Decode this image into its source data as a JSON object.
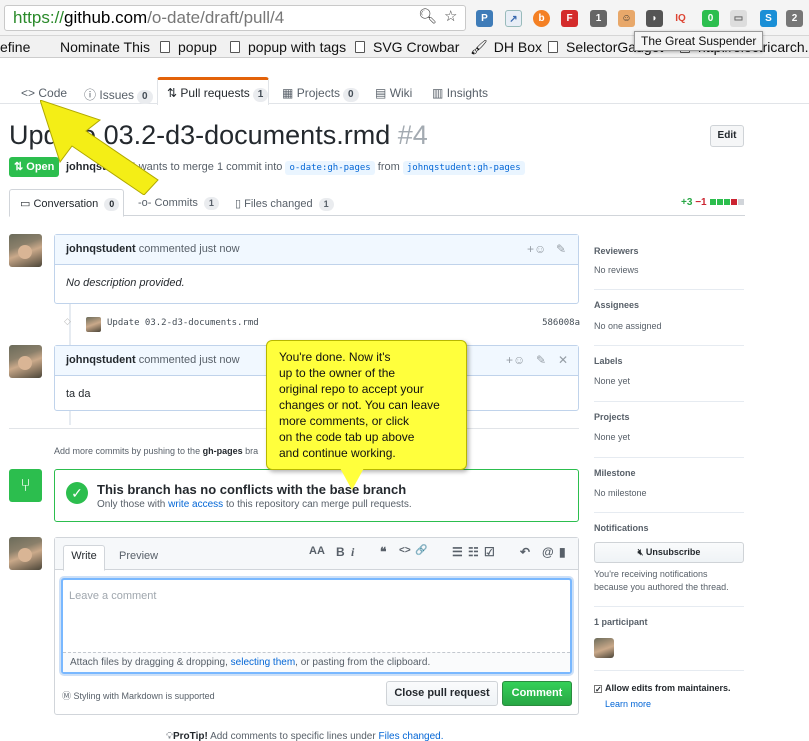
{
  "browser": {
    "url_scheme": "https://",
    "url_host": "github.com",
    "url_path": "/o-date/draft/pull/4",
    "bookmarks": [
      {
        "label": "efine"
      },
      {
        "label": "Nominate This"
      },
      {
        "label": "popup"
      },
      {
        "label": "popup with tags"
      },
      {
        "label": "SVG Crowbar"
      },
      {
        "label": "DH Box"
      },
      {
        "label": "SelectorGadget"
      },
      {
        "label": "http://electricarch."
      }
    ],
    "tooltip": "The Great Suspender",
    "ext_badges": {
      "one": "1",
      "zero": "0",
      "two": "2",
      "iq": "IQ"
    }
  },
  "repo_nav": {
    "code": "Code",
    "issues": "Issues",
    "issues_count": "0",
    "pull_requests": "Pull requests",
    "pull_requests_count": "1",
    "projects": "Projects",
    "projects_count": "0",
    "wiki": "Wiki",
    "insights": "Insights"
  },
  "pr": {
    "title": "Update 03.2-d3-documents.rmd",
    "number": "#4",
    "edit": "Edit",
    "state": "Open",
    "author": "johnqstudent",
    "meta_text": "wants to merge 1 commit into",
    "base_branch": "o-date:gh-pages",
    "from": "from",
    "head_branch": "johnqstudent:gh-pages"
  },
  "pr_tabs": {
    "conversation": "Conversation",
    "conversation_count": "0",
    "commits": "Commits",
    "commits_count": "1",
    "files": "Files changed",
    "files_count": "1",
    "additions": "+3",
    "deletions": "−1"
  },
  "timeline": {
    "comment1": {
      "author": "johnqstudent",
      "action": "commented just now",
      "body": "No description provided."
    },
    "commit": {
      "message": "Update 03.2-d3-documents.rmd",
      "sha": "586008a"
    },
    "comment2": {
      "author": "johnqstudent",
      "action": "commented just now",
      "body": "ta da"
    },
    "add_commits_prefix": "Add more commits by pushing to the",
    "add_commits_branch": "gh-pages",
    "add_commits_suffix": "bra"
  },
  "merge": {
    "title": "This branch has no conflicts with the base branch",
    "sub_prefix": "Only those with",
    "sub_link": "write access",
    "sub_suffix": "to this repository can merge pull requests."
  },
  "form": {
    "write": "Write",
    "preview": "Preview",
    "placeholder": "Leave a comment",
    "attach_prefix": "Attach files by dragging & dropping,",
    "attach_link": "selecting them",
    "attach_suffix": ", or pasting from the clipboard.",
    "markdown_note": "Styling with Markdown is supported",
    "close_button": "Close pull request",
    "comment_button": "Comment",
    "tools": {
      "heading": "AA",
      "bold": "B",
      "italic": "i",
      "quote": "❝",
      "code": "<>",
      "link": "🔗",
      "ul": "☰",
      "ol": "☷",
      "task": "☑",
      "reply": "↶",
      "mention": "@",
      "bookmark": "▮"
    }
  },
  "protip": {
    "label": "ProTip!",
    "text": "Add comments to specific lines under",
    "link": "Files changed."
  },
  "sidebar": {
    "reviewers_h": "Reviewers",
    "reviewers_v": "No reviews",
    "assignees_h": "Assignees",
    "assignees_v": "No one assigned",
    "labels_h": "Labels",
    "labels_v": "None yet",
    "projects_h": "Projects",
    "projects_v": "None yet",
    "milestone_h": "Milestone",
    "milestone_v": "No milestone",
    "notifications_h": "Notifications",
    "unsubscribe": "Unsubscribe",
    "notif_note_1": "You're receiving notifications",
    "notif_note_2": "because you authored the thread.",
    "participants": "1 participant",
    "allow_edits": "Allow edits from maintainers.",
    "learn_more": "Learn more"
  },
  "annotation": {
    "lines": [
      "You're done. Now it's",
      "up to the owner of the",
      "original repo to accept your",
      "changes or not. You can leave",
      "more comments, or click",
      "on the code tab up above",
      "and continue working."
    ]
  },
  "colors": {
    "accent": "#e36209",
    "green": "#2cbe4e",
    "link": "#0366d6",
    "note": "#ffff3c"
  }
}
